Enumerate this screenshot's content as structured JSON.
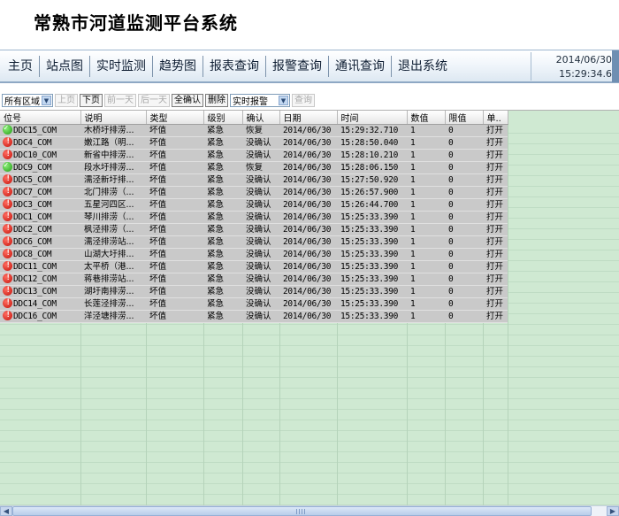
{
  "app": {
    "title": "常熟市河道监测平台系统"
  },
  "nav": {
    "items": [
      "主页",
      "站点图",
      "实时监测",
      "趋势图",
      "报表查询",
      "报警查询",
      "通讯查询",
      "退出系统"
    ],
    "date": "2014/06/30",
    "time": "15:29:34.6"
  },
  "toolbar": {
    "region_select": "所有区域",
    "prev_page": "上页",
    "next_page": "下页",
    "prev_day": "前一天",
    "next_day": "后一天",
    "confirm_all": "全确认",
    "delete": "删除",
    "mode_select": "实时报警",
    "query": "查询"
  },
  "table": {
    "columns": [
      "位号",
      "说明",
      "类型",
      "级别",
      "确认",
      "日期",
      "时间",
      "数值",
      "限值",
      "单.."
    ],
    "rows": [
      {
        "status": "ok",
        "tag": "DDC15_COM",
        "desc": "木桥圩排涝...",
        "type": "坏值",
        "level": "紧急",
        "ack": "恢复",
        "date": "2014/06/30",
        "time": "15:29:32.710",
        "value": "1",
        "limit": "0",
        "unit": "打开"
      },
      {
        "status": "err",
        "tag": "DDC4_COM",
        "desc": "嫩江路（明...",
        "type": "坏值",
        "level": "紧急",
        "ack": "没确认",
        "date": "2014/06/30",
        "time": "15:28:50.040",
        "value": "1",
        "limit": "0",
        "unit": "打开"
      },
      {
        "status": "err",
        "tag": "DDC10_COM",
        "desc": "新省中排涝...",
        "type": "坏值",
        "level": "紧急",
        "ack": "没确认",
        "date": "2014/06/30",
        "time": "15:28:10.210",
        "value": "1",
        "limit": "0",
        "unit": "打开"
      },
      {
        "status": "ok",
        "tag": "DDC9_COM",
        "desc": "段水圩排涝...",
        "type": "坏值",
        "level": "紧急",
        "ack": "恢复",
        "date": "2014/06/30",
        "time": "15:28:06.150",
        "value": "1",
        "limit": "0",
        "unit": "打开"
      },
      {
        "status": "err",
        "tag": "DDC5_COM",
        "desc": "濡泾新圩排...",
        "type": "坏值",
        "level": "紧急",
        "ack": "没确认",
        "date": "2014/06/30",
        "time": "15:27:50.920",
        "value": "1",
        "limit": "0",
        "unit": "打开"
      },
      {
        "status": "err",
        "tag": "DDC7_COM",
        "desc": "北门排涝（...",
        "type": "坏值",
        "level": "紧急",
        "ack": "没确认",
        "date": "2014/06/30",
        "time": "15:26:57.900",
        "value": "1",
        "limit": "0",
        "unit": "打开"
      },
      {
        "status": "err",
        "tag": "DDC3_COM",
        "desc": "五星河四区...",
        "type": "坏值",
        "level": "紧急",
        "ack": "没确认",
        "date": "2014/06/30",
        "time": "15:26:44.700",
        "value": "1",
        "limit": "0",
        "unit": "打开"
      },
      {
        "status": "err",
        "tag": "DDC1_COM",
        "desc": "琴川排涝（...",
        "type": "坏值",
        "level": "紧急",
        "ack": "没确认",
        "date": "2014/06/30",
        "time": "15:25:33.390",
        "value": "1",
        "limit": "0",
        "unit": "打开"
      },
      {
        "status": "err",
        "tag": "DDC2_COM",
        "desc": "枫泾排涝（...",
        "type": "坏值",
        "level": "紧急",
        "ack": "没确认",
        "date": "2014/06/30",
        "time": "15:25:33.390",
        "value": "1",
        "limit": "0",
        "unit": "打开"
      },
      {
        "status": "err",
        "tag": "DDC6_COM",
        "desc": "濡泾排涝站...",
        "type": "坏值",
        "level": "紧急",
        "ack": "没确认",
        "date": "2014/06/30",
        "time": "15:25:33.390",
        "value": "1",
        "limit": "0",
        "unit": "打开"
      },
      {
        "status": "err",
        "tag": "DDC8_COM",
        "desc": "山湖大圩排...",
        "type": "坏值",
        "level": "紧急",
        "ack": "没确认",
        "date": "2014/06/30",
        "time": "15:25:33.390",
        "value": "1",
        "limit": "0",
        "unit": "打开"
      },
      {
        "status": "err",
        "tag": "DDC11_COM",
        "desc": "太平桥（港...",
        "type": "坏值",
        "level": "紧急",
        "ack": "没确认",
        "date": "2014/06/30",
        "time": "15:25:33.390",
        "value": "1",
        "limit": "0",
        "unit": "打开"
      },
      {
        "status": "err",
        "tag": "DDC12_COM",
        "desc": "蒋巷排涝站...",
        "type": "坏值",
        "level": "紧急",
        "ack": "没确认",
        "date": "2014/06/30",
        "time": "15:25:33.390",
        "value": "1",
        "limit": "0",
        "unit": "打开"
      },
      {
        "status": "err",
        "tag": "DDC13_COM",
        "desc": "湖圩南排涝...",
        "type": "坏值",
        "level": "紧急",
        "ack": "没确认",
        "date": "2014/06/30",
        "time": "15:25:33.390",
        "value": "1",
        "limit": "0",
        "unit": "打开"
      },
      {
        "status": "err",
        "tag": "DDC14_COM",
        "desc": "长莲泾排涝...",
        "type": "坏值",
        "level": "紧急",
        "ack": "没确认",
        "date": "2014/06/30",
        "time": "15:25:33.390",
        "value": "1",
        "limit": "0",
        "unit": "打开"
      },
      {
        "status": "err",
        "tag": "DDC16_COM",
        "desc": "洋泾塘排涝...",
        "type": "坏值",
        "level": "紧急",
        "ack": "没确认",
        "date": "2014/06/30",
        "time": "15:25:33.390",
        "value": "1",
        "limit": "0",
        "unit": "打开"
      }
    ]
  },
  "colors": {
    "grid_bg": "#cfe9d2",
    "row_bg": "#c9c9c9",
    "ok_icon": "#1e9b12",
    "err_icon": "#c4120a"
  },
  "icons": {
    "ok": "check-circle-icon",
    "err": "alert-circle-icon"
  }
}
